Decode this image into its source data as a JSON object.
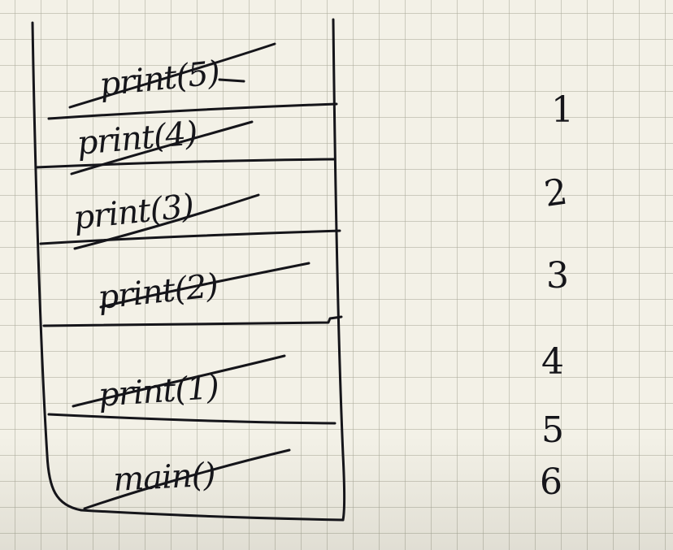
{
  "stack": {
    "frames": [
      {
        "label": "print(5)",
        "crossed_out": true
      },
      {
        "label": "print(4)",
        "crossed_out": true
      },
      {
        "label": "print(3)",
        "crossed_out": true
      },
      {
        "label": "print(2)",
        "crossed_out": true
      },
      {
        "label": "print(1)",
        "crossed_out": true
      },
      {
        "label": "main()",
        "crossed_out": true
      }
    ]
  },
  "order_numbers": [
    "1",
    "2",
    "3",
    "4",
    "5",
    "6"
  ],
  "colors": {
    "ink": "#15151a",
    "paper": "#f3f1e7",
    "grid": "#aaaa9b"
  }
}
